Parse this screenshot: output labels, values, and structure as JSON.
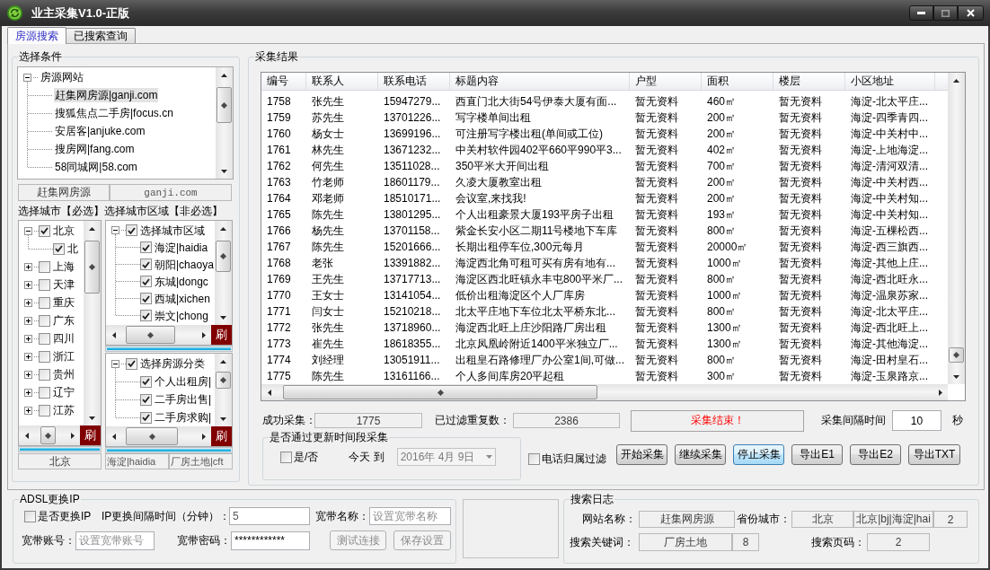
{
  "window": {
    "title": "业主采集V1.0-正版"
  },
  "tabs": [
    {
      "label": "房源搜索",
      "selected": true
    },
    {
      "label": "已搜索查询",
      "selected": false
    }
  ],
  "conditions": {
    "title": "选择条件",
    "site_tree": [
      {
        "label": "房源网站",
        "expanded": true,
        "selected": false,
        "children": [
          {
            "label": "赶集网房源|ganji.com",
            "selected": true
          },
          {
            "label": "搜狐焦点二手房|focus.cn",
            "selected": false
          },
          {
            "label": "安居客|anjuke.com",
            "selected": false
          },
          {
            "label": "搜房网|fang.com",
            "selected": false
          },
          {
            "label": "58同城网|58.com",
            "selected": false
          }
        ]
      }
    ],
    "site_name": "赶集网房源",
    "site_domain": "ganji.com",
    "city_hint": "选择城市【必选】选择城市区域【非必选】",
    "city_tree": {
      "nodes": [
        {
          "label": "北京",
          "expanded": true,
          "checked": true,
          "children": [
            {
              "label": "北",
              "checked": true
            }
          ]
        },
        {
          "label": "上海",
          "expanded": false,
          "checked": false
        },
        {
          "label": "天津",
          "expanded": false,
          "checked": false
        },
        {
          "label": "重庆",
          "expanded": false,
          "checked": false
        },
        {
          "label": "广东",
          "expanded": false,
          "checked": false
        },
        {
          "label": "四川",
          "expanded": false,
          "checked": false
        },
        {
          "label": "浙江",
          "expanded": false,
          "checked": false
        },
        {
          "label": "贵州",
          "expanded": false,
          "checked": false
        },
        {
          "label": "辽宁",
          "expanded": false,
          "checked": false
        },
        {
          "label": "江苏",
          "expanded": false,
          "checked": false
        }
      ],
      "refresh": "刷",
      "progress": {
        "level": 1
      }
    },
    "district_tree": {
      "nodes": [
        {
          "label": "选择城市区域",
          "expanded": true,
          "checked": true,
          "children": [
            {
              "label": "海淀|haidia",
              "checked": true
            },
            {
              "label": "朝阳|chaoya",
              "checked": true
            },
            {
              "label": "东城|dongc",
              "checked": true
            },
            {
              "label": "西城|xichen",
              "checked": true
            },
            {
              "label": "崇文|chong",
              "checked": true
            }
          ]
        }
      ],
      "refresh": "刷",
      "progress": {
        "level": 1
      }
    },
    "category_tree": {
      "nodes": [
        {
          "label": "选择房源分类",
          "expanded": true,
          "checked": true,
          "children": [
            {
              "label": "个人出租房|",
              "checked": true
            },
            {
              "label": "二手房出售|",
              "checked": true
            },
            {
              "label": "二手房求购|",
              "checked": true
            }
          ]
        }
      ],
      "refresh": "刷",
      "progress": {
        "level": 1
      }
    },
    "chosen_city": "北京",
    "chosen_district": "海淀|haidia",
    "chosen_category": "厂房土地|cft"
  },
  "results": {
    "title": "采集结果",
    "table": {
      "columns": [
        "编号",
        "联系人",
        "联系电话",
        "标题内容",
        "户型",
        "面积",
        "楼层",
        "小区地址"
      ],
      "rows": [
        [
          "1758",
          "张先生",
          "15947279...",
          "西直门北大街54号伊泰大厦有面...",
          "暂无资料",
          "460㎡",
          "暂无资料",
          "海淀-北太平庄..."
        ],
        [
          "1759",
          "苏先生",
          "13701226...",
          "写字楼单间出租",
          "暂无资料",
          "200㎡",
          "暂无资料",
          "海淀-四季青四..."
        ],
        [
          "1760",
          "杨女士",
          "13699196...",
          "可注册写字楼出租(单间或工位)",
          "暂无资料",
          "200㎡",
          "暂无资料",
          "海淀-中关村中..."
        ],
        [
          "1761",
          "林先生",
          "13671232...",
          "中关村软件园402平660平990平3...",
          "暂无资料",
          "402㎡",
          "暂无资料",
          "海淀-上地海淀..."
        ],
        [
          "1762",
          "何先生",
          "13511028...",
          "350平米大开间出租",
          "暂无资料",
          "700㎡",
          "暂无资料",
          "海淀-清河双清..."
        ],
        [
          "1763",
          "竹老师",
          "18601179...",
          "久凌大厦教室出租",
          "暂无资料",
          "200㎡",
          "暂无资料",
          "海淀-中关村西..."
        ],
        [
          "1764",
          "邓老师",
          "18510171...",
          "会议室,来找我!",
          "暂无资料",
          "200㎡",
          "暂无资料",
          "海淀-中关村知..."
        ],
        [
          "1765",
          "陈先生",
          "13801295...",
          "个人出租豪景大厦193平房子出租",
          "暂无资料",
          "193㎡",
          "暂无资料",
          "海淀-中关村知..."
        ],
        [
          "1766",
          "杨先生",
          "13701158...",
          "紫金长安小区二期11号楼地下车库",
          "暂无资料",
          "800㎡",
          "暂无资料",
          "海淀-五棵松西..."
        ],
        [
          "1767",
          "陈先生",
          "15201666...",
          "长期出租停车位,300元每月",
          "暂无资料",
          "20000㎡",
          "暂无资料",
          "海淀-西三旗西..."
        ],
        [
          "1768",
          "老张",
          "13391882...",
          "海淀西北角可租可买有房有地有...",
          "暂无资料",
          "1000㎡",
          "暂无资料",
          "海淀-其他上庄..."
        ],
        [
          "1769",
          "王先生",
          "13717713...",
          "海淀区西北旺镇永丰屯800平米厂...",
          "暂无资料",
          "800㎡",
          "暂无资料",
          "海淀-西北旺永..."
        ],
        [
          "1770",
          "王女士",
          "13141054...",
          "低价出租海淀区个人厂库房",
          "暂无资料",
          "1000㎡",
          "暂无资料",
          "海淀-温泉苏家..."
        ],
        [
          "1771",
          "闫女士",
          "15210218...",
          "北太平庄地下车位北太平桥东北...",
          "暂无资料",
          "800㎡",
          "暂无资料",
          "海淀-北太平庄..."
        ],
        [
          "1772",
          "张先生",
          "13718960...",
          "海淀西北旺上庄沙阳路厂房出租",
          "暂无资料",
          "1300㎡",
          "暂无资料",
          "海淀-西北旺上..."
        ],
        [
          "1773",
          "崔先生",
          "18618355...",
          "北京凤凰岭附近1400平米独立厂...",
          "暂无资料",
          "1300㎡",
          "暂无资料",
          "海淀-其他海淀..."
        ],
        [
          "1774",
          "刘经理",
          "13051911...",
          "出租皇石路修理厂办公室1间,可做...",
          "暂无资料",
          "800㎡",
          "暂无资料",
          "海淀-田村皇石..."
        ],
        [
          "1775",
          "陈先生",
          "13161166...",
          "个人多间库房20平起租",
          "暂无资料",
          "300㎡",
          "暂无资料",
          "海淀-玉泉路京..."
        ]
      ]
    },
    "success": {
      "label": "成功采集：",
      "value": "1775"
    },
    "filtered": {
      "label": "已过滤重复数：",
      "value": "2386"
    },
    "status": "采集结束！",
    "interval": {
      "label": "采集间隔时间",
      "value": "10",
      "unit": "秒"
    },
    "period": {
      "title": "是否通过更新时间段采集",
      "checkbox": {
        "label": "是/否",
        "checked": false
      },
      "range_label": "今天 到",
      "date": {
        "value": "2016年 4月 9日",
        "disabled": true
      }
    },
    "phone_filter": {
      "label": "电话归属过滤",
      "checked": false
    },
    "buttons": [
      {
        "label": "开始采集",
        "focused": false
      },
      {
        "label": "继续采集",
        "focused": false
      },
      {
        "label": "停止采集",
        "focused": true
      },
      {
        "label": "导出E1",
        "focused": false
      },
      {
        "label": "导出E2",
        "focused": false
      },
      {
        "label": "导出TXT",
        "focused": false
      }
    ]
  },
  "adsl": {
    "title": "ADSL更换IP",
    "switch": {
      "label": "是否更换IP",
      "checked": false
    },
    "interval": {
      "label": "IP更换间隔时间（分钟）：",
      "value": "5"
    },
    "name": {
      "label": "宽带名称：",
      "placeholder": "设置宽带名称"
    },
    "account": {
      "label": "宽带账号：",
      "placeholder": "设置宽带账号"
    },
    "password": {
      "label": "宽带密码：",
      "value": "************"
    },
    "buttons": [
      {
        "label": "测试连接",
        "disabled": true
      },
      {
        "label": "保存设置",
        "disabled": true
      }
    ]
  },
  "search_log": {
    "title": "搜索日志",
    "site": {
      "label": "网站名称：",
      "value": "赶集网房源"
    },
    "region": {
      "label": "省份城市：",
      "values": [
        "北京",
        "北京|bj|海淀|hai",
        "2"
      ]
    },
    "keyword": {
      "label": "搜索关键词：",
      "values": [
        "厂房土地",
        "8"
      ]
    },
    "page": {
      "label": "搜索页码：",
      "value": "2"
    }
  }
}
